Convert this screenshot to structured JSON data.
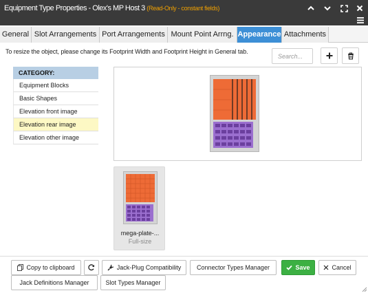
{
  "window": {
    "title": "Equipment Type Properties - Olex's MP Host 3",
    "readonly_note": "(Read-Only - constant fields)",
    "icons": [
      "chevron-up-icon",
      "chevron-down-icon",
      "maximize-icon",
      "close-icon",
      "hamburger-menu-icon"
    ]
  },
  "tabs": [
    {
      "label": "General",
      "active": false
    },
    {
      "label": "Slot Arrangements",
      "active": false
    },
    {
      "label": "Port Arrangements",
      "active": false
    },
    {
      "label": "Mount Point Arrng.",
      "active": false
    },
    {
      "label": "Appearance",
      "active": true
    },
    {
      "label": "Attachments",
      "active": false
    }
  ],
  "hint": "To resize the object, please change its Footprint Width and Footprint Height in General tab.",
  "search": {
    "placeholder": "Search...",
    "value": ""
  },
  "toolbar": {
    "add_icon": "plus-icon",
    "delete_icon": "trash-icon"
  },
  "category": {
    "header": "CATEGORY:",
    "items": [
      {
        "label": "Equipment Blocks",
        "selected": false
      },
      {
        "label": "Basic Shapes",
        "selected": false
      },
      {
        "label": "Elevation front image",
        "selected": false
      },
      {
        "label": "Elevation rear image",
        "selected": true
      },
      {
        "label": "Elevation other image",
        "selected": false
      }
    ]
  },
  "thumbnail": {
    "name": "mega-plate-...",
    "size": "Full-size"
  },
  "colors": {
    "accent": "#3d8fd6",
    "save": "#3cb043",
    "selected_row": "#fdf8c4",
    "plate_orange": "#ee6b36",
    "plate_purple": "#9b6fcf"
  },
  "buttons": {
    "copy": "Copy to clipboard",
    "jack_plug": "Jack-Plug Compatibility",
    "connector": "Connector Types Manager",
    "save": "Save",
    "cancel": "Cancel",
    "jack_defs": "Jack Definitions Manager",
    "slot_types": "Slot Types Manager"
  }
}
